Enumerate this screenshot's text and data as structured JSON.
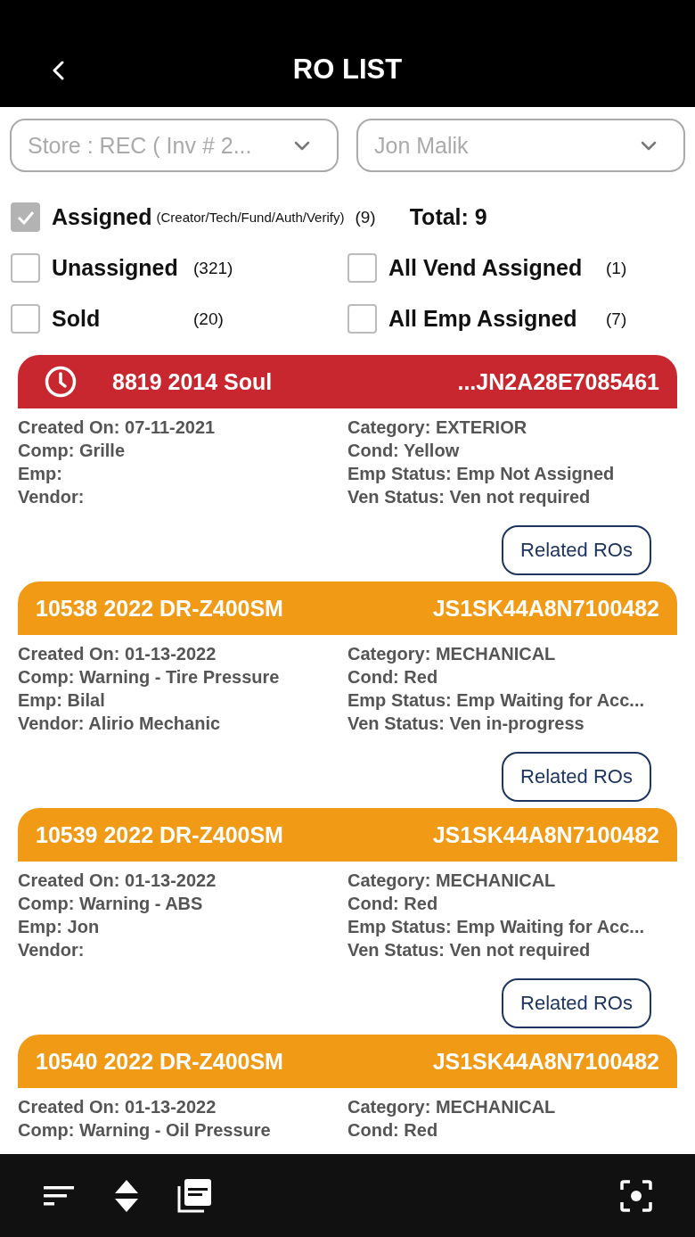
{
  "header": {
    "title": "RO LIST"
  },
  "dropdowns": [
    {
      "value": "Store : REC ( Inv # 2..."
    },
    {
      "value": "Jon Malik"
    }
  ],
  "assigned": {
    "label": "Assigned",
    "note": "(Creator/Tech/Fund/Auth/Verify)",
    "count": "(9)",
    "checked": true
  },
  "total": "Total: 9",
  "filters": [
    {
      "label": "Unassigned",
      "count": "(321)",
      "checked": false
    },
    {
      "label": "All Vend Assigned",
      "count": "(1)",
      "checked": false
    },
    {
      "label": "Sold",
      "count": "(20)",
      "checked": false
    },
    {
      "label": "All Emp Assigned",
      "count": "(7)",
      "checked": false
    }
  ],
  "cards": [
    {
      "title": "8819 2014 Soul",
      "vin": "...JN2A28E7085461",
      "color": "#c9272f",
      "overdue": true,
      "left": [
        "Created On: 07-11-2021",
        "Comp: Grille",
        "Emp:",
        "Vendor:"
      ],
      "right": [
        "Category: EXTERIOR",
        "Cond: Yellow",
        "Emp Status: Emp Not Assigned",
        "Ven Status: Ven not required"
      ],
      "button": "Related ROs"
    },
    {
      "title": "10538 2022 DR-Z400SM",
      "vin": "JS1SK44A8N7100482",
      "color": "#f09a16",
      "overdue": false,
      "left": [
        "Created On: 01-13-2022",
        "Comp: Warning - Tire Pressure",
        "Emp: Bilal",
        "Vendor: Alirio Mechanic"
      ],
      "right": [
        "Category: MECHANICAL",
        "Cond: Red",
        "Emp Status: Emp Waiting for Acc...",
        "Ven Status: Ven in-progress"
      ],
      "button": "Related ROs"
    },
    {
      "title": "10539 2022 DR-Z400SM",
      "vin": "JS1SK44A8N7100482",
      "color": "#f09a16",
      "overdue": false,
      "left": [
        "Created On: 01-13-2022",
        "Comp: Warning - ABS",
        "Emp: Jon",
        "Vendor:"
      ],
      "right": [
        "Category: MECHANICAL",
        "Cond: Red",
        "Emp Status: Emp Waiting for Acc...",
        "Ven Status: Ven not required"
      ],
      "button": "Related ROs"
    },
    {
      "title": "10540 2022 DR-Z400SM",
      "vin": "JS1SK44A8N7100482",
      "color": "#f09a16",
      "overdue": false,
      "left": [
        "Created On: 01-13-2022",
        "Comp: Warning - Oil Pressure"
      ],
      "right": [
        "Category: MECHANICAL",
        "Cond: Red"
      ]
    }
  ]
}
